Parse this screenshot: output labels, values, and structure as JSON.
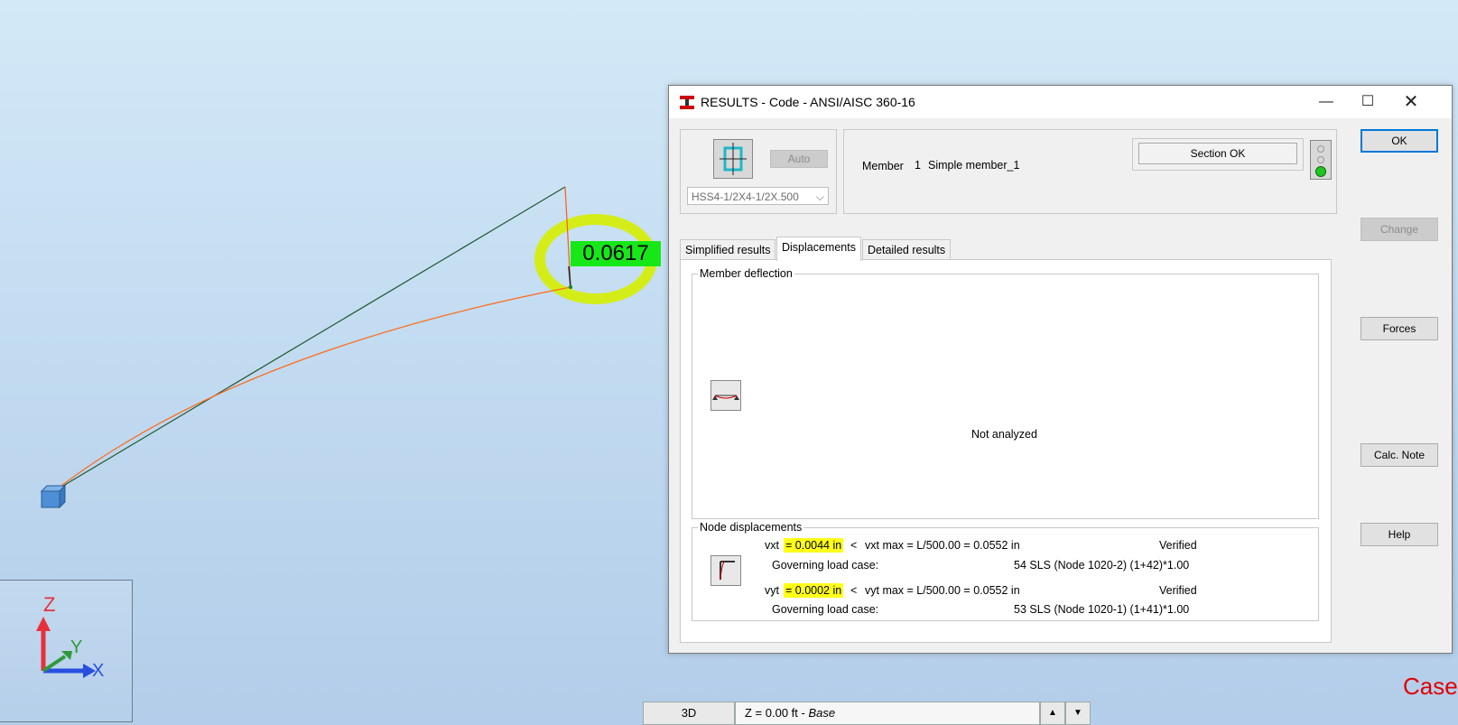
{
  "viewport": {
    "value_label": "0.0617",
    "axes": {
      "z": "Z",
      "y": "Y",
      "x": "X"
    },
    "case_label": "Case",
    "status": {
      "view": "3D",
      "level_prefix": "Z = 0.00 ft - ",
      "level_name": "Base"
    }
  },
  "dialog": {
    "title": "RESULTS - Code - ANSI/AISC 360-16",
    "section": {
      "auto_label": "Auto",
      "selected": "HSS4-1/2X4-1/2X.500"
    },
    "member": {
      "label": "Member",
      "number": "1",
      "name": "Simple member_1"
    },
    "status_text": "Section OK",
    "tabs": [
      {
        "label": "Simplified results"
      },
      {
        "label": "Displacements"
      },
      {
        "label": "Detailed results"
      }
    ],
    "deflection": {
      "legend": "Member deflection",
      "message": "Not analyzed"
    },
    "node": {
      "legend": "Node displacements",
      "vx": {
        "name": "vxt",
        "value": "= 0.0044 in",
        "op": "<",
        "limit": "vxt max = L/500.00 = 0.0552 in",
        "verdict": "Verified",
        "gov_label": "Governing load case:",
        "gov_value": "54 SLS (Node 1020-2)  (1+42)*1.00"
      },
      "vy": {
        "name": "vyt",
        "value": "= 0.0002 in",
        "op": "<",
        "limit": "vyt max = L/500.00 = 0.0552 in",
        "verdict": "Verified",
        "gov_label": "Governing load case:",
        "gov_value": "53 SLS (Node 1020-1)  (1+41)*1.00"
      }
    },
    "buttons": {
      "ok": "OK",
      "change": "Change",
      "forces": "Forces",
      "calc_note": "Calc. Note",
      "help": "Help"
    },
    "colors": {
      "highlight": "#ffff1a",
      "label_bg": "#16e817",
      "status_ok": "#1ec81e"
    }
  }
}
